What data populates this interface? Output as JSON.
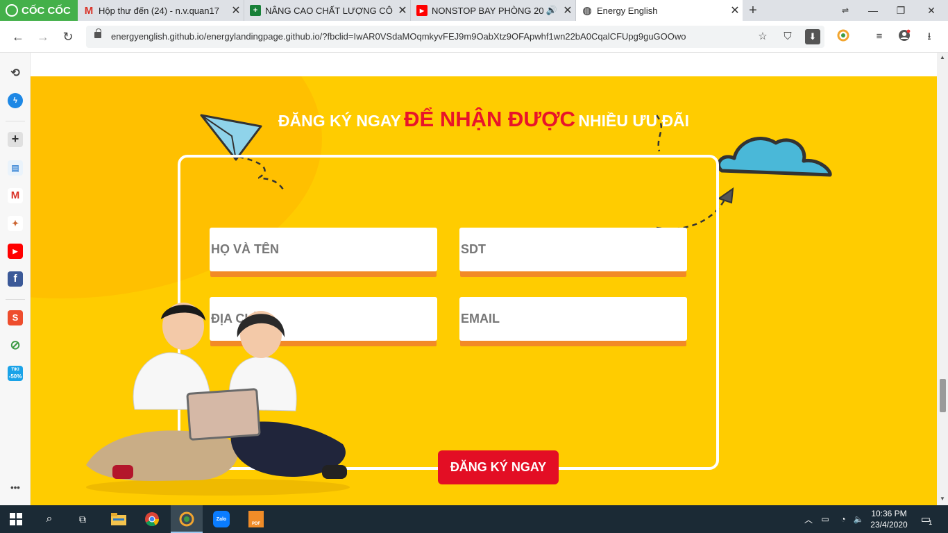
{
  "browser": {
    "brand": "CỐC CỐC",
    "tabs": [
      {
        "title": "Hộp thư đến (24) - n.v.quan17",
        "icon": "gmail-icon"
      },
      {
        "title": "NÂNG CAO CHẤT LƯỢNG CÔ",
        "icon": "sheets-icon"
      },
      {
        "title": "NONSTOP BAY PHÒNG 20",
        "icon": "youtube-icon",
        "audio": true
      },
      {
        "title": "Energy English",
        "icon": "globe-icon",
        "active": true
      }
    ],
    "new_tab": "+",
    "window_controls": [
      "minimize",
      "restore",
      "close"
    ],
    "url": "energyenglish.github.io/energylandingpage.github.io/?fbclid=IwAR0VSdaMOqmkyvFEJ9m9OabXtz9OFApwhf1wn22bA0CqalCFUpg9guGOOwo"
  },
  "sidebar": {
    "items": [
      "history-icon",
      "messenger-icon",
      "add-icon",
      "notes-icon",
      "gmail-icon",
      "shopping-icon",
      "youtube-icon",
      "facebook-icon",
      "shopee-icon",
      "coccoc-icon",
      "discount-icon"
    ],
    "discount_label": "-50%",
    "discount_top": "TIKI",
    "more": "•••"
  },
  "page": {
    "headline": {
      "part1": "ĐĂNG KÝ NGAY",
      "part2": "ĐỂ NHẬN ĐƯỢC",
      "part3": "NHIỀU ƯU ĐÃI"
    },
    "form": {
      "name_placeholder": "HỌ VÀ TÊN",
      "phone_placeholder": "SDT",
      "address_placeholder": "ĐỊA CHỈ",
      "email_placeholder": "EMAIL",
      "submit_label": "ĐĂNG KÝ NGAY"
    },
    "colors": {
      "background": "#ffcc00",
      "circle": "#ffc000",
      "accent_red": "#e8142a",
      "field_shadow": "#f28a26",
      "button": "#e30e24",
      "cloud": "#4ab8d8",
      "plane": "#8fd3ea"
    }
  },
  "taskbar": {
    "apps": [
      "windows-start-icon",
      "search-icon",
      "task-view-icon",
      "file-explorer-icon",
      "chrome-icon",
      "coccoc-icon",
      "zalo-icon",
      "foxit-pdf-icon"
    ],
    "zalo_label": "Zalo",
    "pdf_label": "PDF",
    "time": "10:36 PM",
    "date": "23/4/2020",
    "notifications": "1"
  }
}
